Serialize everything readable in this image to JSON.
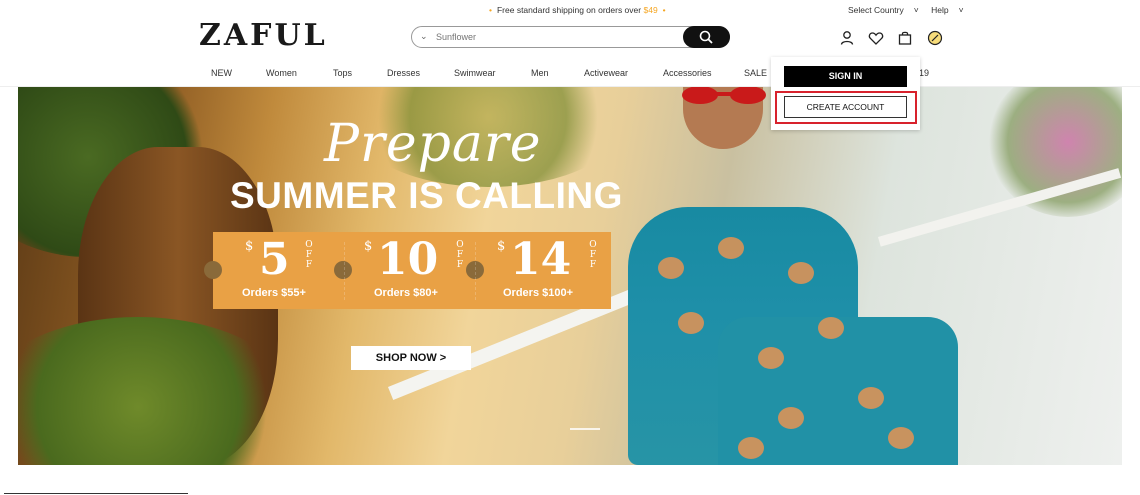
{
  "topbar": {
    "shipping_prefix": "Free standard shipping on orders over",
    "shipping_amount": "$49",
    "select_country": "Select Country",
    "help": "Help"
  },
  "header": {
    "logo": "ZAFUL",
    "search_placeholder": "Sunflower",
    "icons": [
      "user-icon",
      "heart-icon",
      "bag-icon",
      "language-icon"
    ]
  },
  "nav": {
    "items": [
      "NEW",
      "Women",
      "Tops",
      "Dresses",
      "Swimwear",
      "Men",
      "Activewear",
      "Accessories",
      "SALE",
      "19"
    ]
  },
  "account_dropdown": {
    "sign_in": "SIGN IN",
    "create_account": "CREATE ACCOUNT",
    "highlight_color": "#d8222c"
  },
  "banner": {
    "script_title": "Prepare",
    "headline": "SUMMER IS CALLING",
    "offers": [
      {
        "currency": "$",
        "amount": "5",
        "off": "OFF",
        "condition": "Orders $55+"
      },
      {
        "currency": "$",
        "amount": "10",
        "off": "OFF",
        "condition": "Orders $80+"
      },
      {
        "currency": "$",
        "amount": "14",
        "off": "OFF",
        "condition": "Orders $100+"
      }
    ],
    "cta": "SHOP NOW >",
    "offer_color": "#e9a145"
  }
}
